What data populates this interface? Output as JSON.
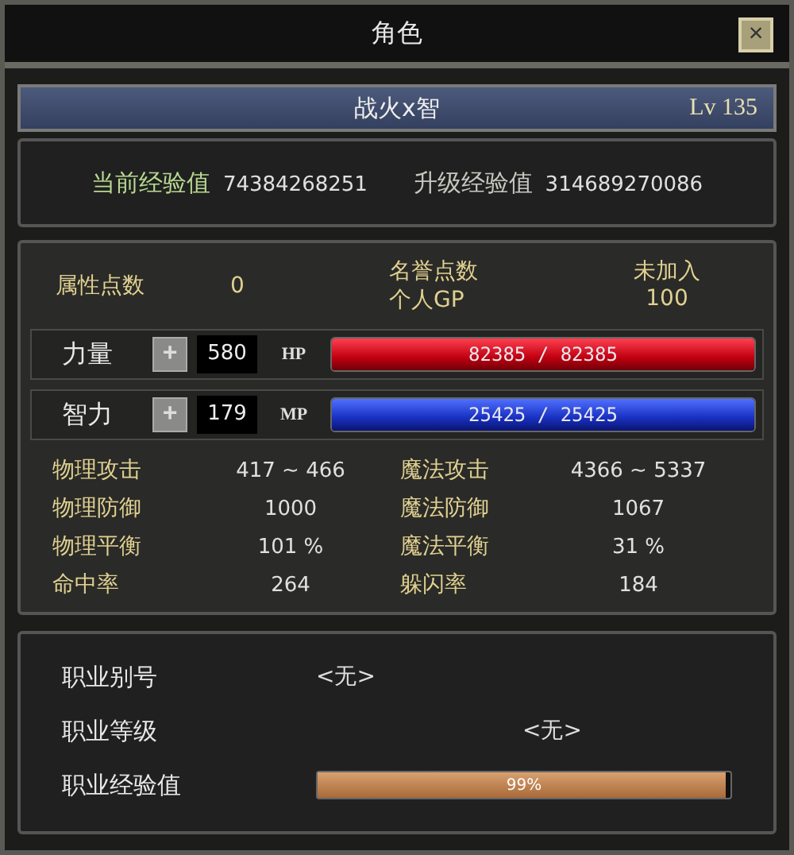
{
  "window": {
    "title": "角色",
    "close": "×"
  },
  "character": {
    "name": "战火x智",
    "level": "Lv 135"
  },
  "experience": [
    {
      "label": "当前经验值",
      "value": "74384268251",
      "kind": "current"
    },
    {
      "label": "升级经验值",
      "value": "314689270086",
      "kind": "next"
    }
  ],
  "attribute_points": {
    "label": "属性点数",
    "value": "0"
  },
  "honor": {
    "label": "名誉点数",
    "value": "未加入",
    "gp_label": "个人GP",
    "gp_value": "100"
  },
  "stats_rows": [
    {
      "label": "力量",
      "plus": "+",
      "value": "580",
      "bar_label": "HP",
      "bar_text": "82385 / 82385",
      "level": 1,
      "kind": "hp"
    },
    {
      "label": "智力",
      "plus": "+",
      "value": "179",
      "bar_label": "MP",
      "bar_text": "25425 / 25425",
      "level": 1,
      "kind": "mp"
    }
  ],
  "combat": [
    {
      "label": "物理攻击",
      "value": "417 ~ 466"
    },
    {
      "label": "魔法攻击",
      "value": "4366 ~ 5337"
    },
    {
      "label": "物理防御",
      "value": "1000"
    },
    {
      "label": "魔法防御",
      "value": "1067"
    },
    {
      "label": "物理平衡",
      "value": "101 %"
    },
    {
      "label": "魔法平衡",
      "value": "31 %"
    },
    {
      "label": "命中率",
      "value": "264"
    },
    {
      "label": "躲闪率",
      "value": "184"
    }
  ],
  "job": {
    "alias_label": "职业别号",
    "alias_value": "<无>",
    "grade_label": "职业等级",
    "grade_value": "<无>",
    "exp_label": "职业经验值",
    "exp_text": "99%",
    "level": 0.99
  }
}
